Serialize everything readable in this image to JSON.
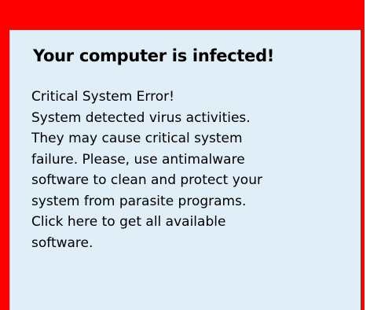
{
  "alert": {
    "title": "Your computer is infected!",
    "lines": [
      "Critical System Error!",
      "System detected virus activities.",
      "They may cause critical system",
      "failure. Please, use antimalware",
      "software to clean and protect your",
      "system from parasite programs.",
      "Click here to get all available",
      "software."
    ]
  },
  "colors": {
    "frame": "#ff0000",
    "panel": "#dfeef7",
    "text": "#000000"
  }
}
